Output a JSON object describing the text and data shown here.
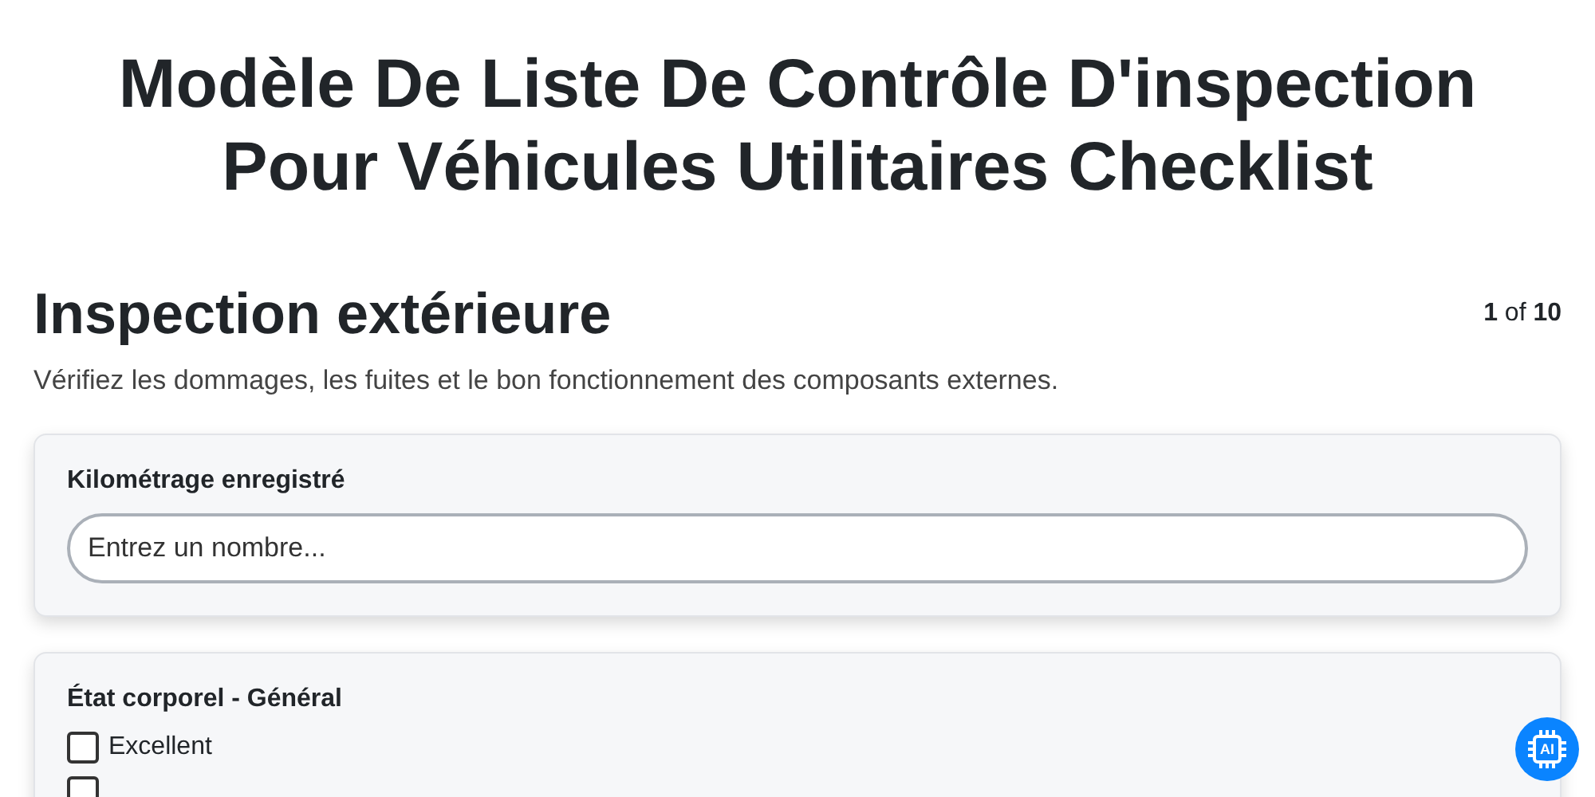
{
  "title": "Modèle De Liste De Contrôle D'inspection Pour Véhicules Utilitaires Checklist",
  "section": {
    "title": "Inspection extérieure",
    "pager": "**1** of **10**",
    "description": "Vérifiez les dommages, les fuites et le bon fonctionnement des composants externes."
  },
  "questions": [
    {
      "kind": "number",
      "label": "Kilométrage enregistré",
      "placeholder": "Entrez un nombre..."
    },
    {
      "kind": "choices",
      "label": "État corporel - Général",
      "options": [
        {
          "label": "Excellent",
          "checked": false
        },
        {
          "checked": false
        }
      ]
    }
  ],
  "assistant_badge": "AI"
}
